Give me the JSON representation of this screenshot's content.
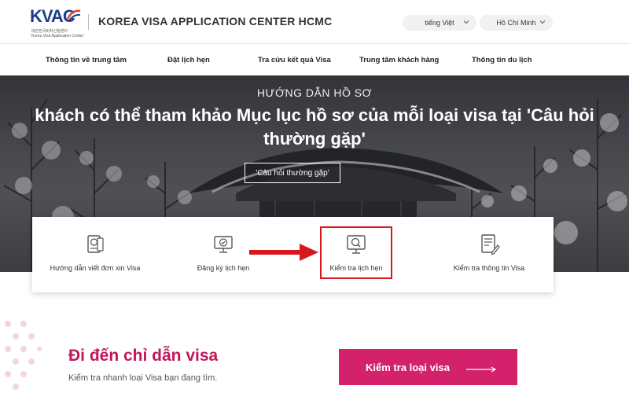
{
  "header": {
    "logo_text": "KVAC",
    "logo_sub_1": "대한민국비자신청센터",
    "logo_sub_2": "Korea Visa Application Center",
    "site_title": "KOREA VISA APPLICATION CENTER HCMC",
    "language_select": "tiếng Việt",
    "city_select": "Hồ Chí Minh"
  },
  "nav": {
    "items": [
      {
        "label": "Thông tin về trung tâm"
      },
      {
        "label": "Đặt lịch hẹn"
      },
      {
        "label": "Tra cứu kết quả Visa"
      },
      {
        "label": "Trung tâm khách hàng"
      },
      {
        "label": "Thông tin du lịch"
      }
    ]
  },
  "hero": {
    "kicker": "HƯỚNG DẪN HỒ SƠ",
    "title_line_1": "khách có thể tham khảo Mục lục hồ sơ của mỗi loại visa tại 'Câu hỏi",
    "title_line_2": "thường gặp'",
    "button_label": "'Câu hỏi thường gặp'"
  },
  "quick_links": [
    {
      "label": "Hướng dẫn viết đơn xin Visa",
      "icon": "passport-icon"
    },
    {
      "label": "Đăng ký lịch hẹn",
      "icon": "monitor-check-icon"
    },
    {
      "label": "Kiểm tra lịch hẹn",
      "icon": "monitor-search-icon",
      "highlighted": true
    },
    {
      "label": "Kiểm tra thông tin Visa",
      "icon": "document-edit-icon"
    }
  ],
  "guide": {
    "title": "Đi đến chỉ dẫn visa",
    "subtitle": "Kiểm tra nhanh loại Visa bạn đang tìm.",
    "cta_label": "Kiểm tra loại visa"
  },
  "colors": {
    "brand_blue": "#1f3d8a",
    "accent_pink": "#d4216c",
    "highlight_red": "#d7181f"
  }
}
